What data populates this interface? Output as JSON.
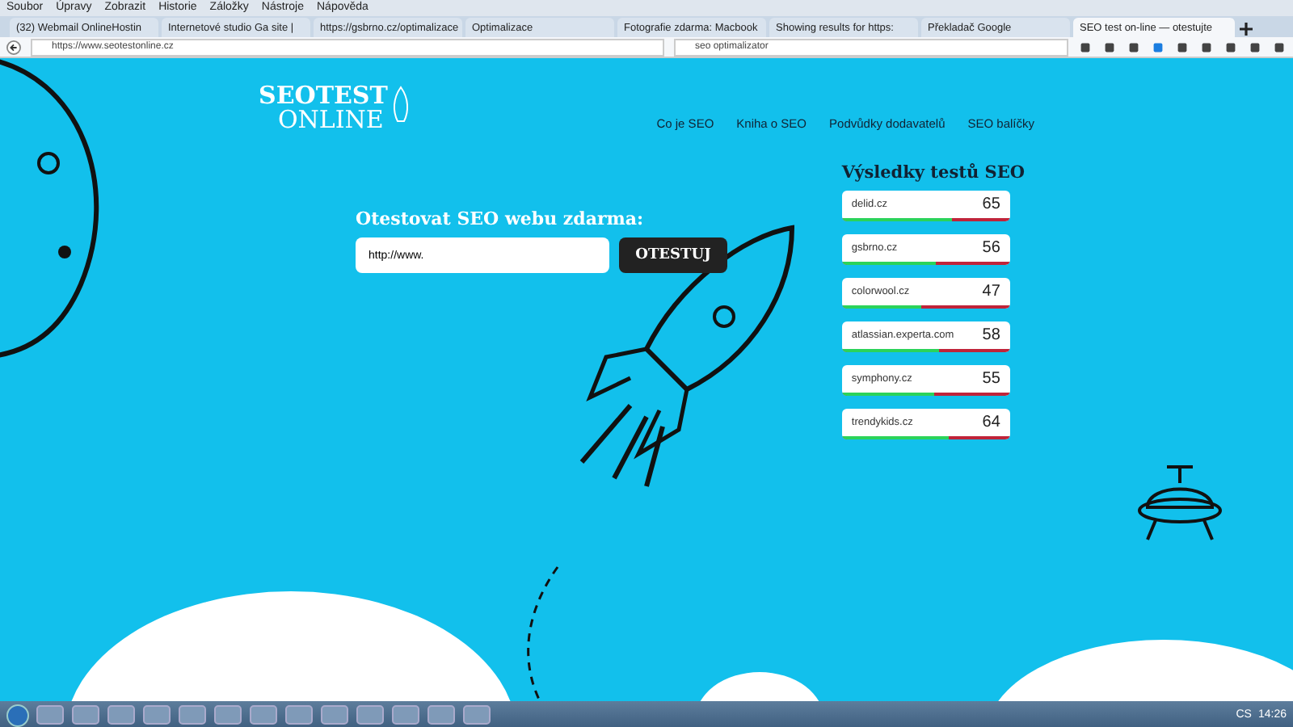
{
  "menu_bar": [
    "Soubor",
    "Úpravy",
    "Zobrazit",
    "Historie",
    "Záložky",
    "Nástroje",
    "Nápověda"
  ],
  "tabs": [
    {
      "label": "(32) Webmail OnlineHostin",
      "selected": false
    },
    {
      "label": "Internetové studio Ga site |",
      "selected": false
    },
    {
      "label": "https://gsbrno.cz/optimalizace",
      "selected": false
    },
    {
      "label": "Optimalizace",
      "selected": false
    },
    {
      "label": "Fotografie zdarma: Macbook",
      "selected": false
    },
    {
      "label": "Showing results for https:",
      "selected": false
    },
    {
      "label": "Překladač Google",
      "selected": false
    },
    {
      "label": "SEO test on-line — otestujte",
      "selected": true
    }
  ],
  "address_bar": {
    "url": "https://www.seotestonline.cz",
    "search": "seo optimalizator"
  },
  "logo": {
    "top": "SEOTEST",
    "bottom": "ONLINE"
  },
  "nav": [
    "Co je SEO",
    "Kniha o SEO",
    "Podvůdky dodavatelů",
    "SEO balíčky"
  ],
  "test_form": {
    "heading": "Otestovat SEO webu zdarma:",
    "url_value": "http://www.",
    "button": "OTESTUJ"
  },
  "results": {
    "heading": "Výsledky testů SEO",
    "items": [
      {
        "site": "delid.cz",
        "score": "65",
        "level": 0.65
      },
      {
        "site": "gsbrno.cz",
        "score": "56",
        "level": 0.56
      },
      {
        "site": "colorwool.cz",
        "score": "47",
        "level": 0.47
      },
      {
        "site": "atlassian.experta.com",
        "score": "58",
        "level": 0.58
      },
      {
        "site": "symphony.cz",
        "score": "55",
        "level": 0.55
      },
      {
        "site": "trendykids.cz",
        "score": "64",
        "level": 0.64
      }
    ]
  },
  "taskbar": {
    "language": "CS",
    "time": "14:26"
  }
}
